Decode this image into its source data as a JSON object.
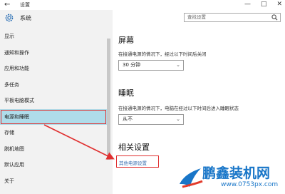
{
  "window": {
    "back_glyph": "←",
    "title": "设置",
    "minimize": "—",
    "maximize": "□",
    "close": "✕"
  },
  "search": {
    "placeholder": "查找设置"
  },
  "sidebar": {
    "title": "系统",
    "items": [
      {
        "label": "显示"
      },
      {
        "label": "通知和操作"
      },
      {
        "label": "应用和功能"
      },
      {
        "label": "多任务"
      },
      {
        "label": "平板电脑模式"
      },
      {
        "label": "电源和睡眠",
        "selected": true
      },
      {
        "label": "存储"
      },
      {
        "label": "脱机地图"
      },
      {
        "label": "默认应用"
      },
      {
        "label": "关于"
      }
    ]
  },
  "screen": {
    "heading": "屏幕",
    "description": "在接通电源的情况下，经过以下时间后关闭",
    "dropdown_value": "30 分钟"
  },
  "sleep": {
    "heading": "睡眠",
    "description": "在接通电源的情况下，电脑在经过以下时间后进入睡眠状态",
    "dropdown_value": "从不"
  },
  "related": {
    "heading": "相关设置",
    "link": "其他电源设置"
  },
  "watermark": {
    "brand": "鹏鑫装机网",
    "url": "www.0753px.com"
  },
  "colors": {
    "selected_bg": "#afdcea",
    "highlight": "#e03030",
    "link": "#3a6fb0",
    "watermark": "#1976c8"
  }
}
